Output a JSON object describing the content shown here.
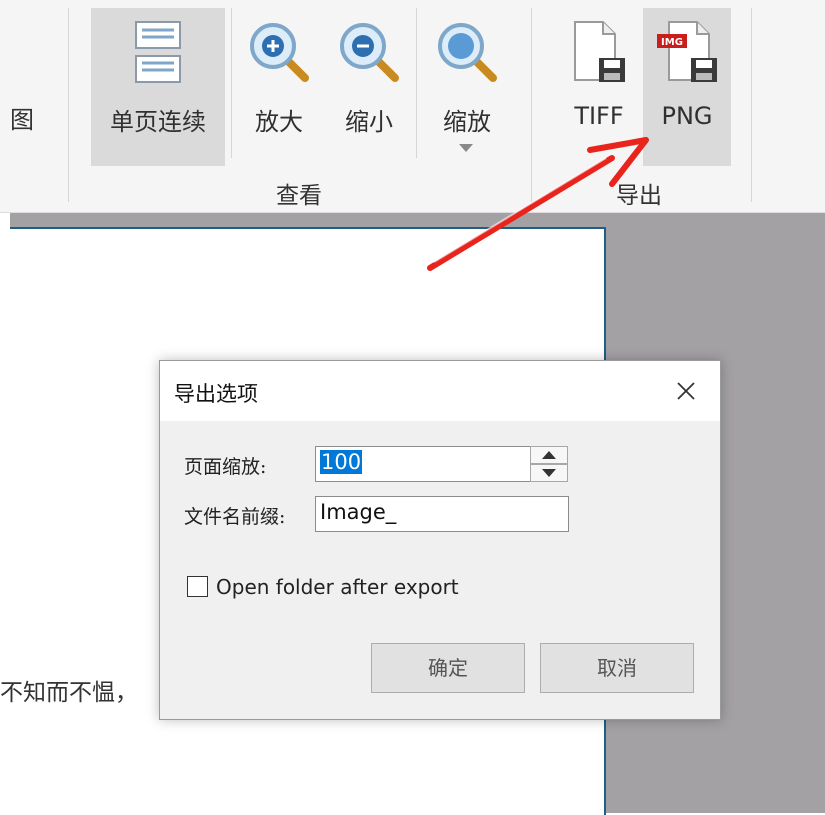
{
  "ribbon": {
    "left_cut_label": "图",
    "buttons": [
      {
        "label": "单页连续"
      },
      {
        "label": "放大"
      },
      {
        "label": "缩小"
      },
      {
        "label": "缩放"
      },
      {
        "label": "TIFF"
      },
      {
        "label": "PNG"
      }
    ],
    "groups": {
      "view": "查看",
      "export": "导出"
    }
  },
  "document": {
    "visible_text": "不知而不愠，"
  },
  "dialog": {
    "title": "导出选项",
    "page_zoom_label": "页面缩放:",
    "page_zoom_value": "100",
    "prefix_label": "文件名前缀:",
    "prefix_value": "Image_",
    "open_folder_label": "Open folder after export",
    "ok_label": "确定",
    "cancel_label": "取消"
  },
  "colors": {
    "arrow": "#e8241c",
    "selection": "#0078d7",
    "workspace": "#a4a1a4"
  },
  "icons": [
    "page-layout-icon",
    "zoom-in-icon",
    "zoom-out-icon",
    "zoom-icon",
    "tiff-save-icon",
    "png-save-icon",
    "close-icon"
  ]
}
